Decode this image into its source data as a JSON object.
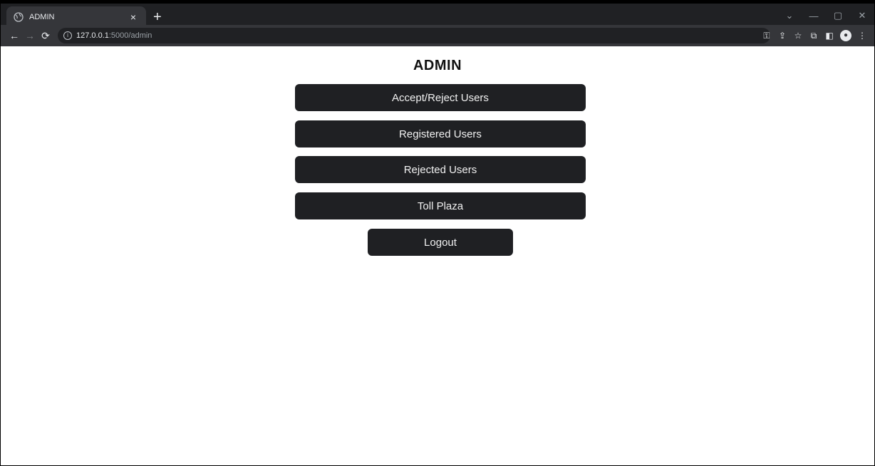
{
  "browser": {
    "tab_title": "ADMIN",
    "tab_close": "×",
    "new_tab": "+",
    "url_host": "127.0.0.1",
    "url_path": ":5000/admin",
    "win_minimize": "—",
    "win_restore": "▢",
    "win_close": "✕",
    "win_dropdown": "⌄"
  },
  "page": {
    "title": "ADMIN",
    "buttons": [
      {
        "label": "Accept/Reject Users"
      },
      {
        "label": "Registered Users"
      },
      {
        "label": "Rejected Users"
      },
      {
        "label": "Toll Plaza"
      }
    ],
    "logout_label": "Logout"
  },
  "colors": {
    "button_bg": "#1f2023",
    "button_text": "#f1f1f1",
    "chrome_dark": "#202124",
    "chrome_toolbar": "#35363a"
  }
}
